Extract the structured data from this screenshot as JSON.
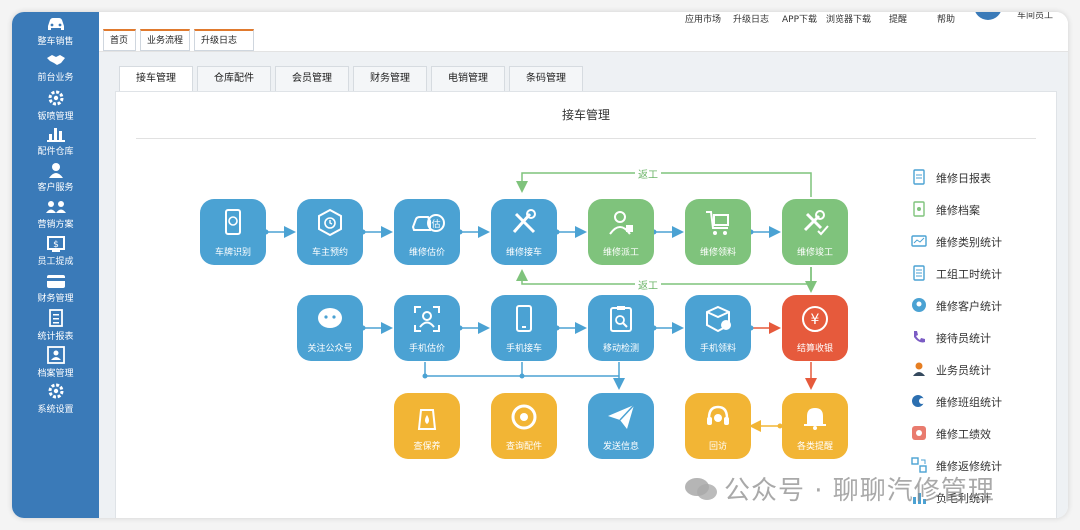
{
  "sidebar": {
    "items": [
      {
        "label": "整车销售",
        "icon": "car-icon"
      },
      {
        "label": "前台业务",
        "icon": "handshake-icon"
      },
      {
        "label": "钣喷管理",
        "icon": "gear-icon"
      },
      {
        "label": "配件仓库",
        "icon": "warehouse-icon"
      },
      {
        "label": "客户服务",
        "icon": "customer-icon"
      },
      {
        "label": "营销方案",
        "icon": "marketing-icon"
      },
      {
        "label": "员工提成",
        "icon": "commission-icon"
      },
      {
        "label": "财务管理",
        "icon": "card-icon"
      },
      {
        "label": "统计报表",
        "icon": "report-icon"
      },
      {
        "label": "档案管理",
        "icon": "archive-icon"
      },
      {
        "label": "系统设置",
        "icon": "settings-icon"
      }
    ]
  },
  "topnav": {
    "links": [
      "应用市场",
      "升级日志",
      "APP下载",
      "浏览器下载",
      "提醒",
      "帮助"
    ],
    "user": "车间员工"
  },
  "tabs": [
    {
      "label": "首页"
    },
    {
      "label": "业务流程"
    },
    {
      "label": "升级日志",
      "close": "×"
    }
  ],
  "module_tabs": [
    "接车管理",
    "仓库配件",
    "会员管理",
    "财务管理",
    "电销管理",
    "条码管理"
  ],
  "panel": {
    "title": "接车管理"
  },
  "flow": {
    "return_label_1": "返工",
    "return_label_2": "返工",
    "row1": [
      "车牌识别",
      "车主预约",
      "维修估价",
      "维修接车",
      "维修派工",
      "维修领料",
      "维修竣工"
    ],
    "row2": [
      "关注公众号",
      "手机估价",
      "手机接车",
      "移动检测",
      "手机领料",
      "结算收银"
    ],
    "row3": [
      "查保养",
      "查询配件",
      "发送信息",
      "回访",
      "各类提醒"
    ],
    "estimate_badge": "估",
    "cashier_symbol": "¥",
    "colors": {
      "blue": "#4ba2d3",
      "green": "#7fc37c",
      "red": "#e65a3c",
      "yellow": "#f2b535"
    }
  },
  "reports": [
    "维修日报表",
    "维修档案",
    "维修类别统计",
    "工组工时统计",
    "维修客户统计",
    "接待员统计",
    "业务员统计",
    "维修班组统计",
    "维修工绩效",
    "维修返修统计",
    "负毛利统计"
  ],
  "watermark": "公众号 · 聊聊汽修管理"
}
